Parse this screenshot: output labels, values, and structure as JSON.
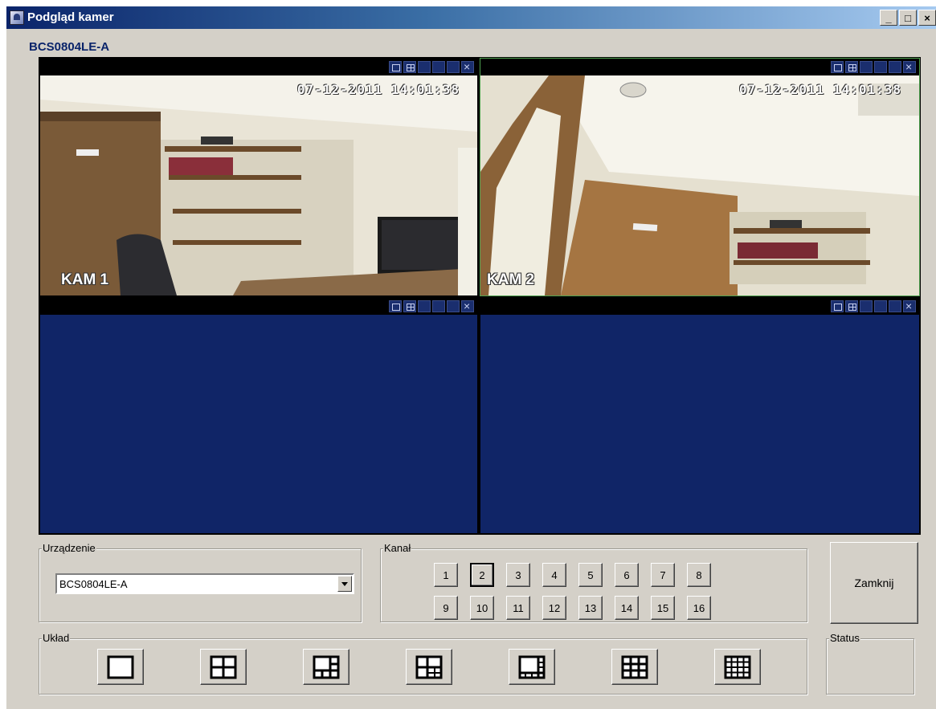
{
  "window": {
    "title": "Podgląd kamer",
    "minimize": "_",
    "maximize": "□",
    "close": "×"
  },
  "device_heading": "BCS0804LE-A",
  "cameras": [
    {
      "timestamp": "07-12-2011  14:01:38",
      "label": "KAM 1"
    },
    {
      "timestamp": "07-12-2011  14:01:38",
      "label": "KAM 2"
    },
    {
      "timestamp": "",
      "label": ""
    },
    {
      "timestamp": "",
      "label": ""
    }
  ],
  "device_group": {
    "label": "Urządzenie",
    "selected": "BCS0804LE-A"
  },
  "channel_group": {
    "label": "Kanał",
    "channels": [
      "1",
      "2",
      "3",
      "4",
      "5",
      "6",
      "7",
      "8",
      "9",
      "10",
      "11",
      "12",
      "13",
      "14",
      "15",
      "16"
    ],
    "active": "2"
  },
  "layout_group": {
    "label": "Układ",
    "layouts": [
      "layout-1-icon",
      "layout-4-icon",
      "layout-6-icon",
      "layout-8-icon",
      "layout-13-icon",
      "layout-9-icon",
      "layout-16-icon"
    ]
  },
  "close_button": "Zamknij",
  "status_group": {
    "label": "Status"
  }
}
